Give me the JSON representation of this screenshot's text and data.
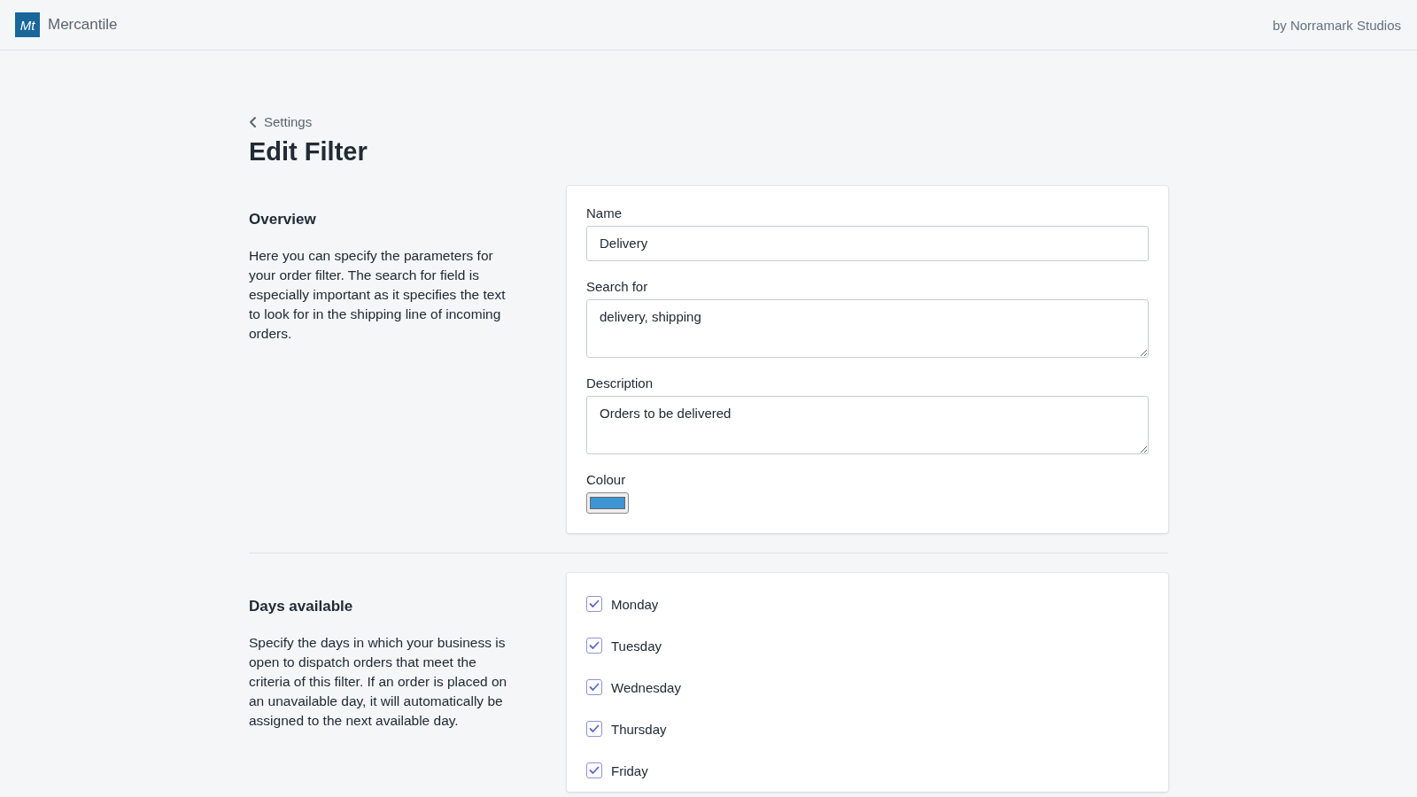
{
  "header": {
    "logo": "Mt",
    "app_name": "Mercantile",
    "byline": "by Norramark Studios"
  },
  "breadcrumb": {
    "label": "Settings"
  },
  "title": "Edit Filter",
  "overview": {
    "heading": "Overview",
    "description": "Here you can specify the parameters for your order filter. The search for field is especially important as it specifies the text to look for in the shipping line of incoming orders.",
    "fields": [
      {
        "kind": "input",
        "label": "Name",
        "value": "Delivery"
      },
      {
        "kind": "textarea",
        "label": "Search for",
        "value": "delivery, shipping"
      },
      {
        "kind": "textarea",
        "label": "Description",
        "value": "Orders to be delivered"
      },
      {
        "kind": "color",
        "label": "Colour",
        "color": "#3d95d3"
      }
    ]
  },
  "days": {
    "heading": "Days available",
    "description": "Specify the days in which your business is open to dispatch orders that meet the criteria of this filter. If an order is placed on an unavailable day, it will automatically be assigned to the next available day.",
    "items": [
      {
        "label": "Monday",
        "checked": true
      },
      {
        "label": "Tuesday",
        "checked": true
      },
      {
        "label": "Wednesday",
        "checked": true
      },
      {
        "label": "Thursday",
        "checked": true
      },
      {
        "label": "Friday",
        "checked": true
      }
    ]
  }
}
